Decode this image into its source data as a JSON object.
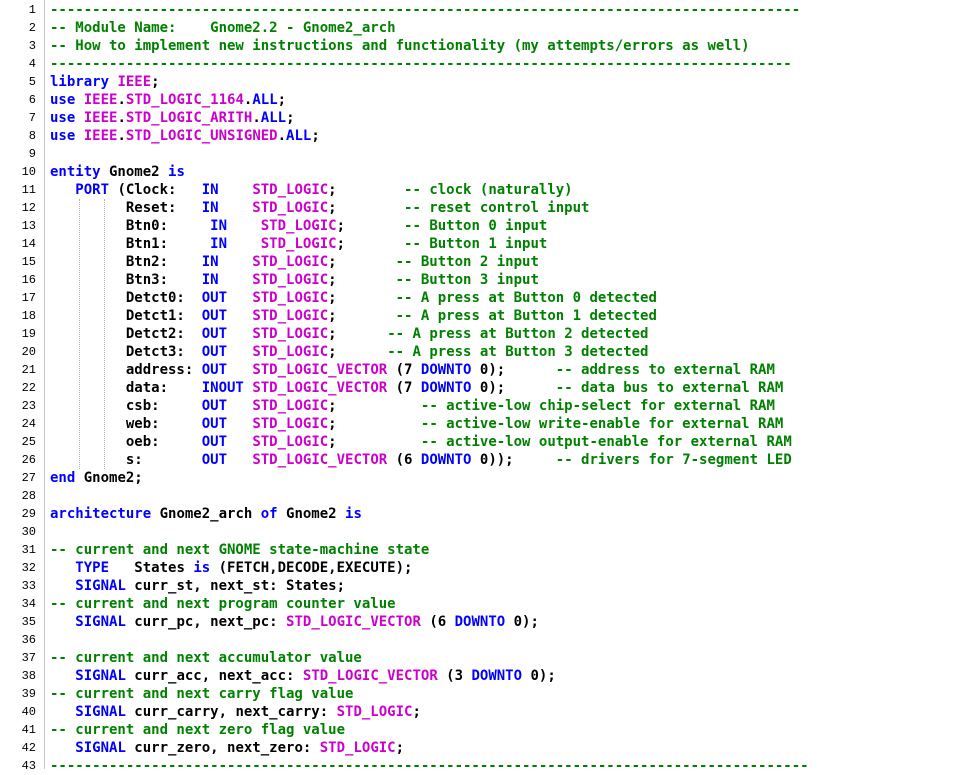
{
  "editor": {
    "lines": [
      {
        "n": "1",
        "s": [
          [
            "-----------------------------------------------------------------------------------------",
            "cm"
          ]
        ]
      },
      {
        "n": "2",
        "s": [
          [
            "-- Module Name:    Gnome2.2 - Gnome2_arch",
            "cm"
          ]
        ]
      },
      {
        "n": "3",
        "s": [
          [
            "-- How to implement new instructions and functionality (my attempts/errors as well)",
            "cm"
          ]
        ]
      },
      {
        "n": "4",
        "s": [
          [
            "----------------------------------------------------------------------------------------",
            "cm"
          ]
        ]
      },
      {
        "n": "5",
        "s": [
          [
            "library",
            "kw"
          ],
          [
            " ",
            "pl"
          ],
          [
            "IEEE",
            "ty"
          ],
          [
            ";",
            "pl"
          ]
        ]
      },
      {
        "n": "6",
        "s": [
          [
            "use",
            "kw"
          ],
          [
            " ",
            "pl"
          ],
          [
            "IEEE",
            "ty"
          ],
          [
            ".",
            "pl"
          ],
          [
            "STD_LOGIC_1164",
            "ty"
          ],
          [
            ".",
            "pl"
          ],
          [
            "ALL",
            "kw"
          ],
          [
            ";",
            "pl"
          ]
        ]
      },
      {
        "n": "7",
        "s": [
          [
            "use",
            "kw"
          ],
          [
            " ",
            "pl"
          ],
          [
            "IEEE",
            "ty"
          ],
          [
            ".",
            "pl"
          ],
          [
            "STD_LOGIC_ARITH",
            "ty"
          ],
          [
            ".",
            "pl"
          ],
          [
            "ALL",
            "kw"
          ],
          [
            ";",
            "pl"
          ]
        ]
      },
      {
        "n": "8",
        "s": [
          [
            "use",
            "kw"
          ],
          [
            " ",
            "pl"
          ],
          [
            "IEEE",
            "ty"
          ],
          [
            ".",
            "pl"
          ],
          [
            "STD_LOGIC_UNSIGNED",
            "ty"
          ],
          [
            ".",
            "pl"
          ],
          [
            "ALL",
            "kw"
          ],
          [
            ";",
            "pl"
          ]
        ]
      },
      {
        "n": "9",
        "s": []
      },
      {
        "n": "10",
        "s": [
          [
            "entity",
            "kw"
          ],
          [
            " Gnome2 ",
            "pl"
          ],
          [
            "is",
            "kw"
          ]
        ]
      },
      {
        "n": "11",
        "s": [
          [
            "   ",
            "pl"
          ],
          [
            "PORT",
            "kw"
          ],
          [
            " (Clock:   ",
            "pl"
          ],
          [
            "IN",
            "kw"
          ],
          [
            "    ",
            "pl"
          ],
          [
            "STD_LOGIC",
            "ty"
          ],
          [
            ";        ",
            "pl"
          ],
          [
            "-- clock (naturally)",
            "cm"
          ]
        ]
      },
      {
        "n": "12",
        "s": [
          [
            "         Reset:   ",
            "pl"
          ],
          [
            "IN",
            "kw"
          ],
          [
            "    ",
            "pl"
          ],
          [
            "STD_LOGIC",
            "ty"
          ],
          [
            ";        ",
            "pl"
          ],
          [
            "-- reset control input",
            "cm"
          ]
        ]
      },
      {
        "n": "13",
        "s": [
          [
            "         Btn0:     ",
            "pl"
          ],
          [
            "IN",
            "kw"
          ],
          [
            "    ",
            "pl"
          ],
          [
            "STD_LOGIC",
            "ty"
          ],
          [
            ";       ",
            "pl"
          ],
          [
            "-- Button 0 input",
            "cm"
          ]
        ]
      },
      {
        "n": "14",
        "s": [
          [
            "         Btn1:     ",
            "pl"
          ],
          [
            "IN",
            "kw"
          ],
          [
            "    ",
            "pl"
          ],
          [
            "STD_LOGIC",
            "ty"
          ],
          [
            ";       ",
            "pl"
          ],
          [
            "-- Button 1 input",
            "cm"
          ]
        ]
      },
      {
        "n": "15",
        "s": [
          [
            "         Btn2:    ",
            "pl"
          ],
          [
            "IN",
            "kw"
          ],
          [
            "    ",
            "pl"
          ],
          [
            "STD_LOGIC",
            "ty"
          ],
          [
            ";       ",
            "pl"
          ],
          [
            "-- Button 2 input",
            "cm"
          ]
        ]
      },
      {
        "n": "16",
        "s": [
          [
            "         Btn3:    ",
            "pl"
          ],
          [
            "IN",
            "kw"
          ],
          [
            "    ",
            "pl"
          ],
          [
            "STD_LOGIC",
            "ty"
          ],
          [
            ";       ",
            "pl"
          ],
          [
            "-- Button 3 input",
            "cm"
          ]
        ]
      },
      {
        "n": "17",
        "s": [
          [
            "         Detct0:  ",
            "pl"
          ],
          [
            "OUT",
            "kw"
          ],
          [
            "   ",
            "pl"
          ],
          [
            "STD_LOGIC",
            "ty"
          ],
          [
            ";       ",
            "pl"
          ],
          [
            "-- A press at Button 0 detected",
            "cm"
          ]
        ]
      },
      {
        "n": "18",
        "s": [
          [
            "         Detct1:  ",
            "pl"
          ],
          [
            "OUT",
            "kw"
          ],
          [
            "   ",
            "pl"
          ],
          [
            "STD_LOGIC",
            "ty"
          ],
          [
            ";       ",
            "pl"
          ],
          [
            "-- A press at Button 1 detected",
            "cm"
          ]
        ]
      },
      {
        "n": "19",
        "s": [
          [
            "         Detct2:  ",
            "pl"
          ],
          [
            "OUT",
            "kw"
          ],
          [
            "   ",
            "pl"
          ],
          [
            "STD_LOGIC",
            "ty"
          ],
          [
            ";      ",
            "pl"
          ],
          [
            "-- A press at Button 2 detected",
            "cm"
          ]
        ]
      },
      {
        "n": "20",
        "s": [
          [
            "         Detct3:  ",
            "pl"
          ],
          [
            "OUT",
            "kw"
          ],
          [
            "   ",
            "pl"
          ],
          [
            "STD_LOGIC",
            "ty"
          ],
          [
            ";      ",
            "pl"
          ],
          [
            "-- A press at Button 3 detected",
            "cm"
          ]
        ]
      },
      {
        "n": "21",
        "s": [
          [
            "         address: ",
            "pl"
          ],
          [
            "OUT",
            "kw"
          ],
          [
            "   ",
            "pl"
          ],
          [
            "STD_LOGIC_VECTOR",
            "ty"
          ],
          [
            " (7 ",
            "pl"
          ],
          [
            "DOWNTO",
            "kw"
          ],
          [
            " 0);      ",
            "pl"
          ],
          [
            "-- address to external RAM",
            "cm"
          ]
        ]
      },
      {
        "n": "22",
        "s": [
          [
            "         data:    ",
            "pl"
          ],
          [
            "INOUT",
            "kw"
          ],
          [
            " ",
            "pl"
          ],
          [
            "STD_LOGIC_VECTOR",
            "ty"
          ],
          [
            " (7 ",
            "pl"
          ],
          [
            "DOWNTO",
            "kw"
          ],
          [
            " 0);      ",
            "pl"
          ],
          [
            "-- data bus to external RAM",
            "cm"
          ]
        ]
      },
      {
        "n": "23",
        "s": [
          [
            "         csb:     ",
            "pl"
          ],
          [
            "OUT",
            "kw"
          ],
          [
            "   ",
            "pl"
          ],
          [
            "STD_LOGIC",
            "ty"
          ],
          [
            ";          ",
            "pl"
          ],
          [
            "-- active-low chip-select for external RAM",
            "cm"
          ]
        ]
      },
      {
        "n": "24",
        "s": [
          [
            "         web:     ",
            "pl"
          ],
          [
            "OUT",
            "kw"
          ],
          [
            "   ",
            "pl"
          ],
          [
            "STD_LOGIC",
            "ty"
          ],
          [
            ";          ",
            "pl"
          ],
          [
            "-- active-low write-enable for external RAM",
            "cm"
          ]
        ]
      },
      {
        "n": "25",
        "s": [
          [
            "         oeb:     ",
            "pl"
          ],
          [
            "OUT",
            "kw"
          ],
          [
            "   ",
            "pl"
          ],
          [
            "STD_LOGIC",
            "ty"
          ],
          [
            ";          ",
            "pl"
          ],
          [
            "-- active-low output-enable for external RAM",
            "cm"
          ]
        ]
      },
      {
        "n": "26",
        "s": [
          [
            "         s:       ",
            "pl"
          ],
          [
            "OUT",
            "kw"
          ],
          [
            "   ",
            "pl"
          ],
          [
            "STD_LOGIC_VECTOR",
            "ty"
          ],
          [
            " (6 ",
            "pl"
          ],
          [
            "DOWNTO",
            "kw"
          ],
          [
            " 0));     ",
            "pl"
          ],
          [
            "-- drivers for 7-segment LED",
            "cm"
          ]
        ]
      },
      {
        "n": "27",
        "s": [
          [
            "end",
            "kw"
          ],
          [
            " Gnome2;",
            "pl"
          ]
        ]
      },
      {
        "n": "28",
        "s": []
      },
      {
        "n": "29",
        "s": [
          [
            "architecture",
            "kw"
          ],
          [
            " Gnome2_arch ",
            "pl"
          ],
          [
            "of",
            "kw"
          ],
          [
            " Gnome2 ",
            "pl"
          ],
          [
            "is",
            "kw"
          ]
        ]
      },
      {
        "n": "30",
        "s": []
      },
      {
        "n": "31",
        "s": [
          [
            "-- current and next GNOME state-machine state",
            "cm"
          ]
        ]
      },
      {
        "n": "32",
        "s": [
          [
            "   ",
            "pl"
          ],
          [
            "TYPE",
            "kw"
          ],
          [
            "   States ",
            "pl"
          ],
          [
            "is",
            "kw"
          ],
          [
            " (FETCH,DECODE,EXECUTE);",
            "pl"
          ]
        ]
      },
      {
        "n": "33",
        "s": [
          [
            "   ",
            "pl"
          ],
          [
            "SIGNAL",
            "kw"
          ],
          [
            " curr_st, next_st: States;",
            "pl"
          ]
        ]
      },
      {
        "n": "34",
        "s": [
          [
            "-- current and next program counter value",
            "cm"
          ]
        ]
      },
      {
        "n": "35",
        "s": [
          [
            "   ",
            "pl"
          ],
          [
            "SIGNAL",
            "kw"
          ],
          [
            " curr_pc, next_pc: ",
            "pl"
          ],
          [
            "STD_LOGIC_VECTOR",
            "ty"
          ],
          [
            " (6 ",
            "pl"
          ],
          [
            "DOWNTO",
            "kw"
          ],
          [
            " 0);",
            "pl"
          ]
        ]
      },
      {
        "n": "36",
        "s": []
      },
      {
        "n": "37",
        "s": [
          [
            "-- current and next accumulator value",
            "cm"
          ]
        ]
      },
      {
        "n": "38",
        "s": [
          [
            "   ",
            "pl"
          ],
          [
            "SIGNAL",
            "kw"
          ],
          [
            " curr_acc, next_acc: ",
            "pl"
          ],
          [
            "STD_LOGIC_VECTOR",
            "ty"
          ],
          [
            " (3 ",
            "pl"
          ],
          [
            "DOWNTO",
            "kw"
          ],
          [
            " 0);",
            "pl"
          ]
        ]
      },
      {
        "n": "39",
        "s": [
          [
            "-- current and next carry flag value",
            "cm"
          ]
        ]
      },
      {
        "n": "40",
        "s": [
          [
            "   ",
            "pl"
          ],
          [
            "SIGNAL",
            "kw"
          ],
          [
            " curr_carry, next_carry: ",
            "pl"
          ],
          [
            "STD_LOGIC",
            "ty"
          ],
          [
            ";",
            "pl"
          ]
        ]
      },
      {
        "n": "41",
        "s": [
          [
            "-- current and next zero flag value",
            "cm"
          ]
        ]
      },
      {
        "n": "42",
        "s": [
          [
            "   ",
            "pl"
          ],
          [
            "SIGNAL",
            "kw"
          ],
          [
            " curr_zero, next_zero: ",
            "pl"
          ],
          [
            "STD_LOGIC",
            "ty"
          ],
          [
            ";",
            "pl"
          ]
        ]
      },
      {
        "n": "43",
        "s": [
          [
            "------------------------------------------------------------------------------------------",
            "cm"
          ]
        ]
      }
    ]
  }
}
